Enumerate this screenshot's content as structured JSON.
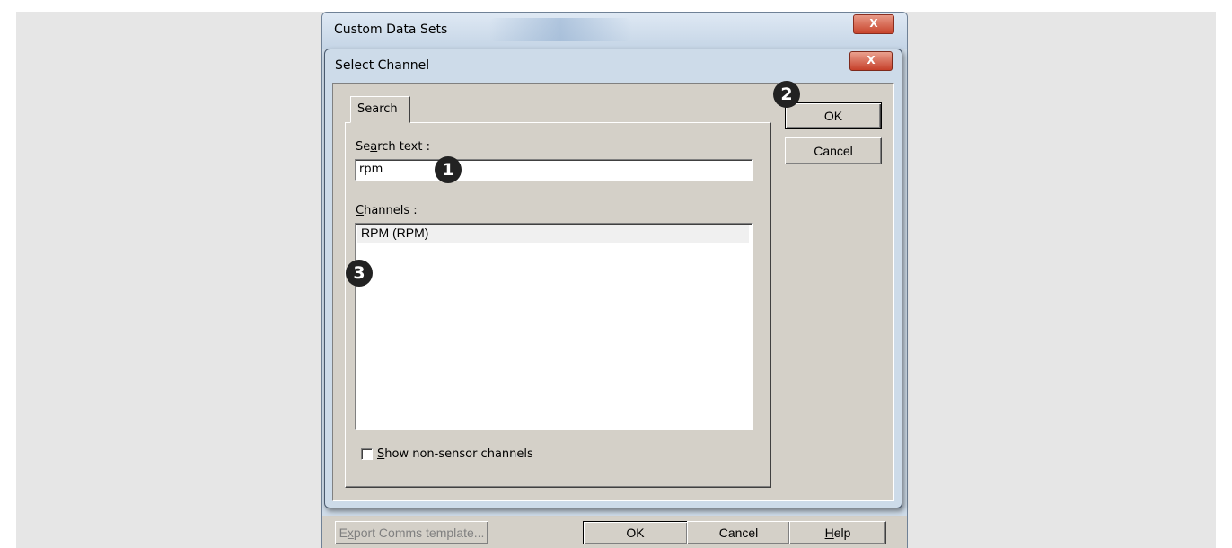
{
  "parent_window": {
    "title": "Custom Data Sets",
    "close_glyph": "X",
    "buttons": {
      "export": "Export Comms template...",
      "ok": "OK",
      "cancel": "Cancel",
      "help": "Help"
    }
  },
  "dialog": {
    "title": "Select Channel",
    "close_glyph": "X",
    "tab_label": "Search",
    "search_label": "Search text :",
    "search_value": "rpm",
    "channels_label": "Channels :",
    "channels": [
      "RPM (RPM)"
    ],
    "selected_channel_index": 0,
    "show_nonsensor_label": "Show non-sensor channels",
    "show_nonsensor_checked": false,
    "ok_label": "OK",
    "cancel_label": "Cancel"
  },
  "callouts": [
    "1",
    "2",
    "3"
  ]
}
